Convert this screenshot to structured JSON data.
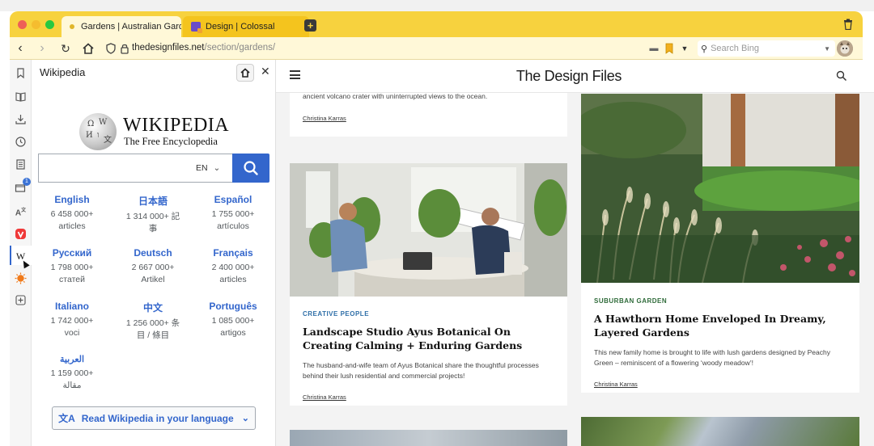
{
  "browser": {
    "tabs": [
      {
        "title": "Gardens | Australian Garde",
        "active": true
      },
      {
        "title": "Design | Colossal",
        "active": false
      }
    ],
    "new_tab": "+",
    "url_domain": "thedesignfiles.net",
    "url_path": "/section/gardens/",
    "search_placeholder": "Search Bing",
    "side_badge": "1",
    "colors": {
      "tabbar": "#f7d23e",
      "addressbar": "#fff8d8"
    }
  },
  "sidebar_icons": [
    "bookmark-icon",
    "reading-list-icon",
    "downloads-icon",
    "history-icon",
    "notes-icon",
    "mail-icon",
    "translate-icon",
    "vivaldi-icon",
    "wikipedia-icon",
    "sun-icon",
    "add-panel-icon"
  ],
  "wikipedia": {
    "panel_title": "Wikipedia",
    "wordmark": "WIKIPEDIA",
    "tagline": "The Free Encyclopedia",
    "search_lang": "EN",
    "languages": [
      {
        "name": "English",
        "count": "6 458 000+",
        "unit": "articles"
      },
      {
        "name": "日本語",
        "count": "1 314 000+ 記",
        "unit": "事"
      },
      {
        "name": "Español",
        "count": "1 755 000+",
        "unit": "artículos"
      },
      {
        "name": "Русский",
        "count": "1 798 000+",
        "unit": "статей"
      },
      {
        "name": "Deutsch",
        "count": "2 667 000+",
        "unit": "Artikel"
      },
      {
        "name": "Français",
        "count": "2 400 000+",
        "unit": "articles"
      },
      {
        "name": "Italiano",
        "count": "1 742 000+",
        "unit": "voci"
      },
      {
        "name": "中文",
        "count": "1 256 000+ 条",
        "unit": "目 / 條目"
      },
      {
        "name": "Português",
        "count": "1 085 000+",
        "unit": "artigos"
      },
      {
        "name": "العربية",
        "count": "1 159 000+",
        "unit": "مقالة"
      }
    ],
    "read_button": "Read Wikipedia in your language"
  },
  "site": {
    "title": "The Design Files",
    "cards": [
      {
        "excerpt": "ancient volcano crater with uninterrupted views to the ocean.",
        "author": "Christina Karras"
      },
      {
        "tag": "CREATIVE PEOPLE",
        "tag_color": "#2f6fa8",
        "headline": "Landscape Studio Ayus Botanical On Creating Calming + Enduring Gardens",
        "excerpt": "The husband-and-wife team of Ayus Botanical share the thoughtful processes behind their lush residential and commercial projects!",
        "author": "Christina Karras"
      },
      {
        "tag": "SUBURBAN GARDEN",
        "tag_color": "#2f6b3a",
        "headline": "A Hawthorn Home Enveloped In Dreamy, Layered Gardens",
        "excerpt": "This new family home is brought to life with lush gardens designed by Peachy Green – reminiscent of a flowering ‘woody meadow’!",
        "author": "Christina Karras"
      }
    ]
  }
}
